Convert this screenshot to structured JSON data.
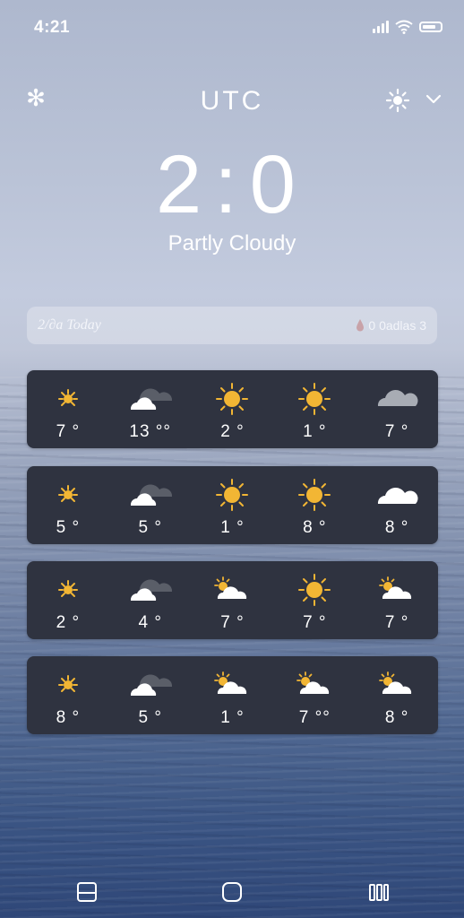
{
  "status_bar": {
    "time": "4:21"
  },
  "header": {
    "location": "UTC"
  },
  "current": {
    "temperature": "2:0",
    "condition": "Partly Cloudy"
  },
  "summary": {
    "left": "2/∂a Today",
    "right": "0 0adlas 3"
  },
  "forecast": [
    {
      "cells": [
        {
          "icon": "sun-small-icon",
          "temp": "7 °"
        },
        {
          "icon": "partly-cloudy-dark-icon",
          "temp": "13 °°"
        },
        {
          "icon": "sun-icon",
          "temp": "2 °"
        },
        {
          "icon": "sun-icon",
          "temp": "1 °"
        },
        {
          "icon": "overcast-icon",
          "temp": "7 °"
        }
      ]
    },
    {
      "cells": [
        {
          "icon": "sun-small-icon",
          "temp": "5 °"
        },
        {
          "icon": "partly-cloudy-dark-icon",
          "temp": "5 °"
        },
        {
          "icon": "sun-icon",
          "temp": "1 °"
        },
        {
          "icon": "sun-icon",
          "temp": "8 °"
        },
        {
          "icon": "cloud-icon",
          "temp": "8 °"
        }
      ]
    },
    {
      "cells": [
        {
          "icon": "sun-small-icon",
          "temp": "2 °"
        },
        {
          "icon": "partly-cloudy-dark-icon",
          "temp": "4 °"
        },
        {
          "icon": "partly-sunny-icon",
          "temp": "7 °"
        },
        {
          "icon": "sun-icon",
          "temp": "7 °"
        },
        {
          "icon": "partly-sunny-icon",
          "temp": "7 °"
        }
      ]
    },
    {
      "cells": [
        {
          "icon": "sun-small-icon",
          "temp": "8 °"
        },
        {
          "icon": "partly-cloudy-dark-icon",
          "temp": "5 °"
        },
        {
          "icon": "partly-sunny-icon",
          "temp": "1 °"
        },
        {
          "icon": "partly-sunny-icon",
          "temp": "7 °°"
        },
        {
          "icon": "partly-sunny-icon",
          "temp": "8 °"
        }
      ]
    }
  ],
  "colors": {
    "card_background": "#2f3340",
    "sun": "#f2b634",
    "text": "#ffffff"
  }
}
